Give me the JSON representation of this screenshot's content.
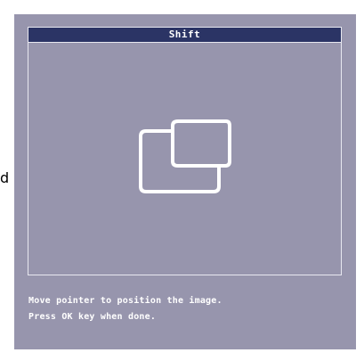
{
  "background": {
    "letter": "d"
  },
  "osd": {
    "title": "Shift",
    "icon": "shift-windows-icon",
    "instructions": {
      "line1": "Move pointer to position the image.",
      "line2": "Press OK key when done."
    },
    "colors": {
      "panel": "#9795ad",
      "title_bar": "#2b3465",
      "text": "#ffffff"
    }
  }
}
